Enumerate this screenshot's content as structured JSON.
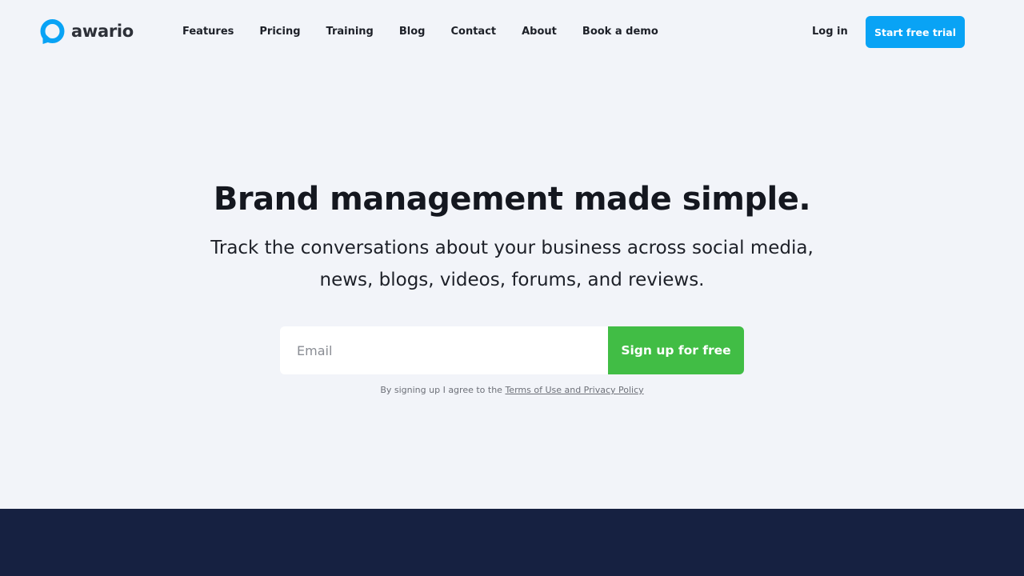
{
  "brand": {
    "name": "awario",
    "accent": "#09a3f5",
    "logo_icon": "speech-bubble-q-icon"
  },
  "nav": {
    "items": [
      "Features",
      "Pricing",
      "Training",
      "Blog",
      "Contact",
      "About",
      "Book a demo"
    ],
    "login_label": "Log in",
    "trial_label": "Start free trial"
  },
  "hero": {
    "title": "Brand management made simple.",
    "subtitle_line1": "Track the conversations about your business across social media,",
    "subtitle_line2": "news, blogs, videos, forums, and reviews."
  },
  "signup": {
    "email_placeholder": "Email",
    "email_value": "",
    "button_label": "Sign up for free",
    "button_color": "#41bd45"
  },
  "terms": {
    "prefix": "By signing up I agree to the",
    "link_label": "Terms of Use and Privacy Policy"
  },
  "colors": {
    "background": "#f2f4f9",
    "footer": "#162141"
  }
}
